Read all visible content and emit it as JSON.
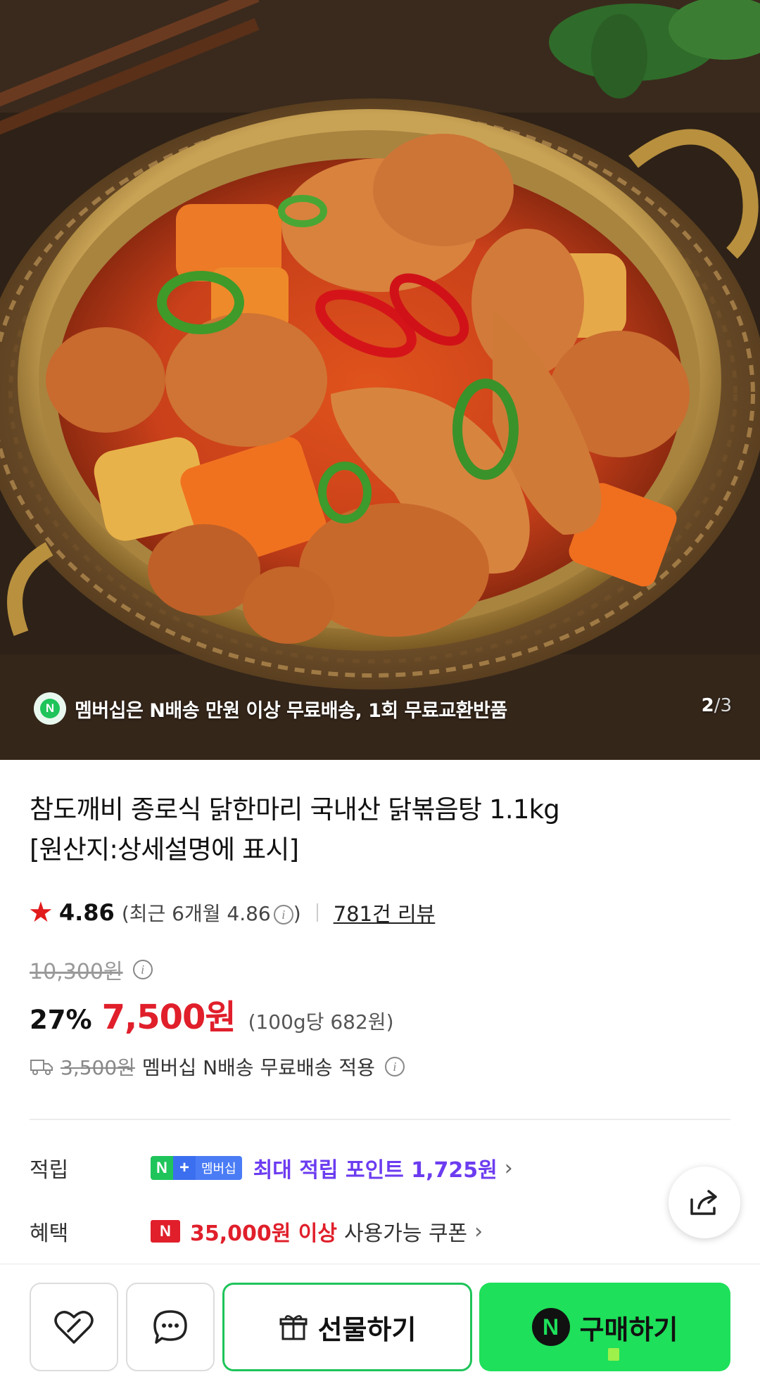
{
  "hero": {
    "badge_icon": "N",
    "badge_text": "멤버십은 N배송 만원 이상 무료배송, 1회 무료교환반품",
    "page_current": "2",
    "page_separator": "/",
    "page_total": "3"
  },
  "product": {
    "title_line1": "참도깨비 종로식 닭한마리 국내산 닭볶음탕 1.1kg",
    "title_line2": "[원산지:상세설명에 표시]",
    "rating": "4.86",
    "recent_rating": "(최근 6개월 4.86",
    "recent_close": ")",
    "review_count": "781건 리뷰",
    "original_price": "10,300원",
    "discount_rate": "27%",
    "sale_price": "7,500원",
    "unit_price": "(100g당 682원)",
    "shipping_old": "3,500원",
    "shipping_text": "멤버십 N배송 무료배송 적용"
  },
  "benefits": {
    "points_label": "적립",
    "badge_n": "N",
    "badge_plus": "+",
    "badge_member": "멤버십",
    "points_text": "최대 적립 포인트 1,725원",
    "coupon_label": "혜택",
    "coupon_badge": "N",
    "coupon_amount": "35,000원 이상",
    "coupon_text": "사용가능 쿠폰"
  },
  "bottom_bar": {
    "gift_label": "선물하기",
    "buy_badge": "N",
    "buy_label": "구매하기"
  },
  "colors": {
    "naver_green": "#1ee05a",
    "sale_red": "#e01f2b",
    "points_purple": "#6c3cf0",
    "star_red": "#e21c1c"
  }
}
